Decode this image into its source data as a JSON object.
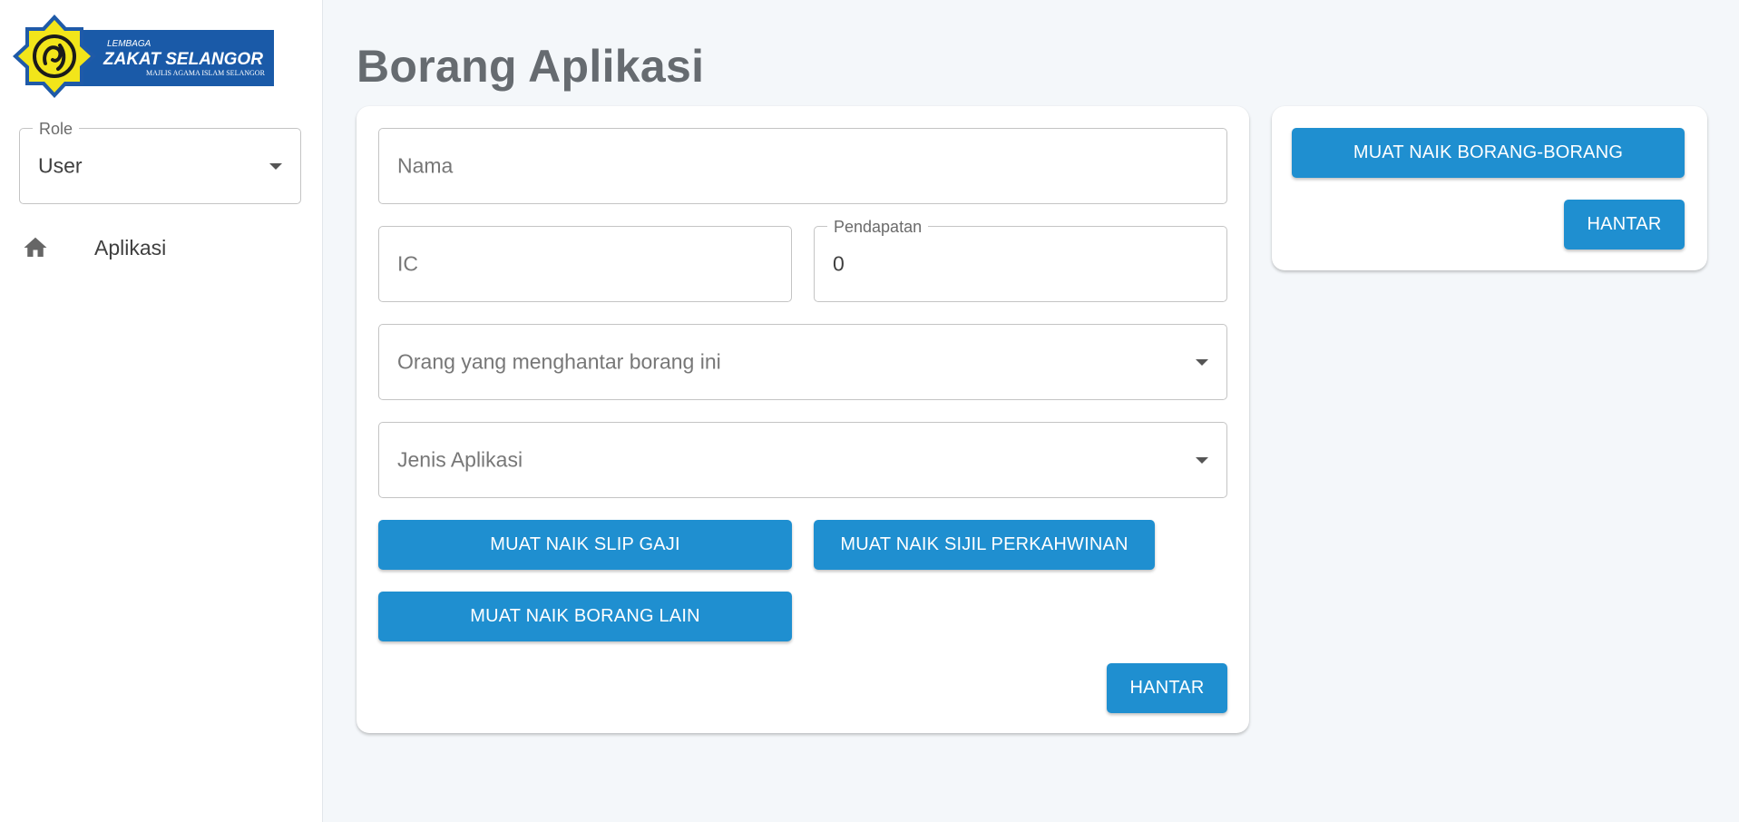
{
  "brand": {
    "logo_small_text": "LEMBAGA",
    "logo_name": "ZAKAT SELANGOR",
    "logo_subtitle": "MAJLIS AGAMA ISLAM SELANGOR",
    "colors": {
      "logo_blue": "#1a5aa8",
      "logo_yellow": "#f2e51a",
      "accent_button": "#1f8fd0"
    }
  },
  "sidebar": {
    "role_select": {
      "label": "Role",
      "value": "User"
    },
    "nav_items": [
      {
        "label": "Aplikasi",
        "icon": "home-icon"
      }
    ]
  },
  "main": {
    "title": "Borang Aplikasi",
    "form": {
      "nama": {
        "placeholder": "Nama"
      },
      "ic": {
        "placeholder": "IC"
      },
      "pendapatan": {
        "label": "Pendapatan",
        "value": "0"
      },
      "pengirim": {
        "placeholder": "Orang yang menghantar borang ini"
      },
      "jenis": {
        "placeholder": "Jenis Aplikasi"
      },
      "buttons": {
        "slip_gaji": "MUAT NAIK SLIP GAJI",
        "sijil_perkahwinan": "MUAT NAIK SIJIL PERKAHWINAN",
        "borang_lain": "MUAT NAIK BORANG LAIN",
        "hantar": "HANTAR"
      }
    }
  },
  "side_card": {
    "upload_button": "MUAT NAIK BORANG-BORANG",
    "hantar_button": "HANTAR"
  }
}
